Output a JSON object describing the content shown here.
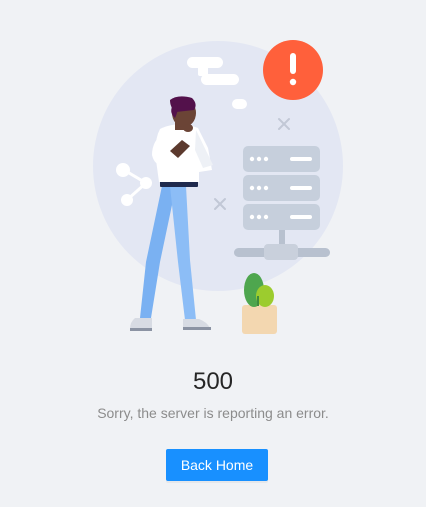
{
  "result": {
    "status_code": "500",
    "message": "Sorry, the server is reporting an error.",
    "action_label": "Back Home"
  },
  "colors": {
    "background": "#f0f2f5",
    "primary_button": "#1890ff",
    "error_badge": "#ff603b",
    "title_text": "#262626",
    "subtitle_text": "#8c8c8c"
  },
  "icons": [
    "error-exclamation-icon",
    "share-network-icon",
    "server-rack-icon",
    "plant-icon",
    "chat-bubble-icon"
  ]
}
